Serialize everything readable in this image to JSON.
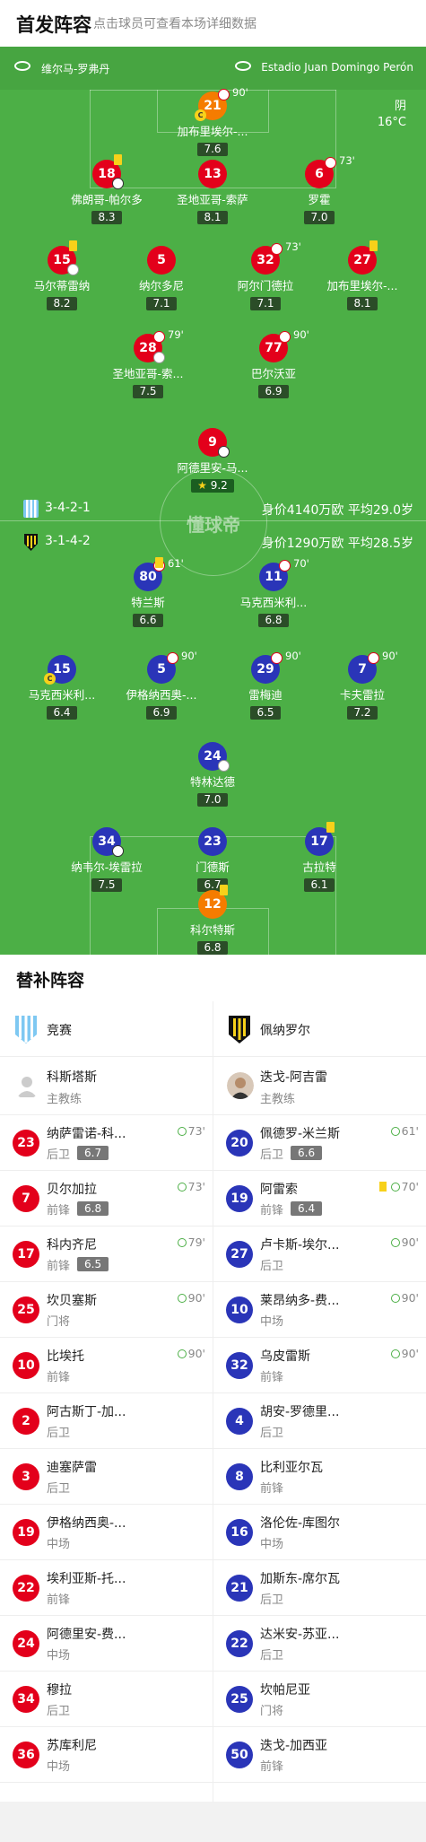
{
  "header": {
    "title": "首发阵容",
    "subtitle": "点击球员可查看本场详细数据"
  },
  "venue": {
    "city": "维尔马-罗弗丹",
    "stadium": "Estadio Juan Domingo Perón"
  },
  "weather": {
    "condition": "阴",
    "temperature": "16°C"
  },
  "home": {
    "name": "竞赛",
    "formation": "3-4-2-1",
    "value": "身价4140万欧 平均29.0岁",
    "color": "#e3001b"
  },
  "away": {
    "name": "佩纳罗尔",
    "formation": "3-1-4-2",
    "value": "身价1290万欧 平均28.5岁",
    "color": "#2a35b8"
  },
  "watermark": "懂球帝",
  "home_players": [
    {
      "num": "21",
      "name": "加布里埃尔-...",
      "rating": "7.6",
      "minute": "90'",
      "captain": true,
      "color": "orange"
    },
    {
      "num": "18",
      "name": "佛朗哥-帕尔多",
      "rating": "8.3",
      "yellow": true,
      "ball": true
    },
    {
      "num": "13",
      "name": "圣地亚哥-索萨",
      "rating": "8.1"
    },
    {
      "num": "6",
      "name": "罗霍",
      "rating": "7.0",
      "minute": "73'"
    },
    {
      "num": "15",
      "name": "马尔蒂雷纳",
      "rating": "8.2",
      "yellow": true,
      "assist": true
    },
    {
      "num": "5",
      "name": "纳尔多尼",
      "rating": "7.1"
    },
    {
      "num": "32",
      "name": "阿尔门德拉",
      "rating": "7.1",
      "minute": "73'"
    },
    {
      "num": "27",
      "name": "加布里埃尔-...",
      "rating": "8.1",
      "yellow": true
    },
    {
      "num": "28",
      "name": "圣地亚哥-索...",
      "rating": "7.5",
      "minute": "79'",
      "assist": true
    },
    {
      "num": "77",
      "name": "巴尔沃亚",
      "rating": "6.9",
      "minute": "90'"
    },
    {
      "num": "9",
      "name": "阿德里安-马...",
      "rating": "9.2",
      "ball": true,
      "star": true
    }
  ],
  "away_players": [
    {
      "num": "80",
      "name": "特兰斯",
      "rating": "6.6",
      "minute": "61'",
      "yellow": true
    },
    {
      "num": "11",
      "name": "马克西米利...",
      "rating": "6.8",
      "minute": "70'"
    },
    {
      "num": "15",
      "name": "马克西米利...",
      "rating": "6.4",
      "captain": true
    },
    {
      "num": "5",
      "name": "伊格纳西奥-...",
      "rating": "6.9",
      "minute": "90'"
    },
    {
      "num": "29",
      "name": "雷梅迪",
      "rating": "6.5",
      "minute": "90'"
    },
    {
      "num": "7",
      "name": "卡夫雷拉",
      "rating": "7.2",
      "minute": "90'"
    },
    {
      "num": "24",
      "name": "特林达德",
      "rating": "7.0",
      "assist": true
    },
    {
      "num": "34",
      "name": "纳韦尔-埃雷拉",
      "rating": "7.5",
      "ball": true
    },
    {
      "num": "23",
      "name": "门德斯",
      "rating": "6.7"
    },
    {
      "num": "17",
      "name": "古拉特",
      "rating": "6.1",
      "yellow": true
    },
    {
      "num": "12",
      "name": "科尔特斯",
      "rating": "6.8",
      "yellow": true,
      "color": "orange"
    }
  ],
  "bench": {
    "title": "替补阵容",
    "home": {
      "coach": {
        "name": "科斯塔斯",
        "role": "主教练"
      },
      "subs": [
        {
          "num": "23",
          "name": "纳萨雷诺-科...",
          "pos": "后卫",
          "rating": "6.7",
          "minute": "73'"
        },
        {
          "num": "7",
          "name": "贝尔加拉",
          "pos": "前锋",
          "rating": "6.8",
          "minute": "73'"
        },
        {
          "num": "17",
          "name": "科内齐尼",
          "pos": "前锋",
          "rating": "6.5",
          "minute": "79'"
        },
        {
          "num": "25",
          "name": "坎贝塞斯",
          "pos": "门将",
          "minute": "90'"
        },
        {
          "num": "10",
          "name": "比埃托",
          "pos": "前锋",
          "minute": "90'"
        },
        {
          "num": "2",
          "name": "阿古斯丁-加...",
          "pos": "后卫"
        },
        {
          "num": "3",
          "name": "迪塞萨雷",
          "pos": "后卫"
        },
        {
          "num": "19",
          "name": "伊格纳西奥-...",
          "pos": "中场"
        },
        {
          "num": "22",
          "name": "埃利亚斯-托...",
          "pos": "前锋"
        },
        {
          "num": "24",
          "name": "阿德里安-费...",
          "pos": "中场"
        },
        {
          "num": "34",
          "name": "穆拉",
          "pos": "后卫"
        },
        {
          "num": "36",
          "name": "苏库利尼",
          "pos": "中场"
        }
      ]
    },
    "away": {
      "coach": {
        "name": "迭戈-阿吉雷",
        "role": "主教练"
      },
      "subs": [
        {
          "num": "20",
          "name": "佩德罗-米兰斯",
          "pos": "后卫",
          "rating": "6.6",
          "minute": "61'"
        },
        {
          "num": "19",
          "name": "阿雷索",
          "pos": "前锋",
          "rating": "6.4",
          "minute": "70'",
          "yellow": true
        },
        {
          "num": "27",
          "name": "卢卡斯-埃尔...",
          "pos": "后卫",
          "minute": "90'"
        },
        {
          "num": "10",
          "name": "莱昂纳多-费...",
          "pos": "中场",
          "minute": "90'"
        },
        {
          "num": "32",
          "name": "乌皮雷斯",
          "pos": "前锋",
          "minute": "90'"
        },
        {
          "num": "4",
          "name": "胡安-罗德里...",
          "pos": "后卫"
        },
        {
          "num": "8",
          "name": "比利亚尔瓦",
          "pos": "前锋"
        },
        {
          "num": "16",
          "name": "洛伦佐-库图尔",
          "pos": "中场"
        },
        {
          "num": "21",
          "name": "加斯东-席尔瓦",
          "pos": "后卫"
        },
        {
          "num": "22",
          "name": "达米安-苏亚...",
          "pos": "后卫"
        },
        {
          "num": "25",
          "name": "坎帕尼亚",
          "pos": "门将"
        },
        {
          "num": "50",
          "name": "迭戈-加西亚",
          "pos": "前锋"
        }
      ]
    }
  }
}
